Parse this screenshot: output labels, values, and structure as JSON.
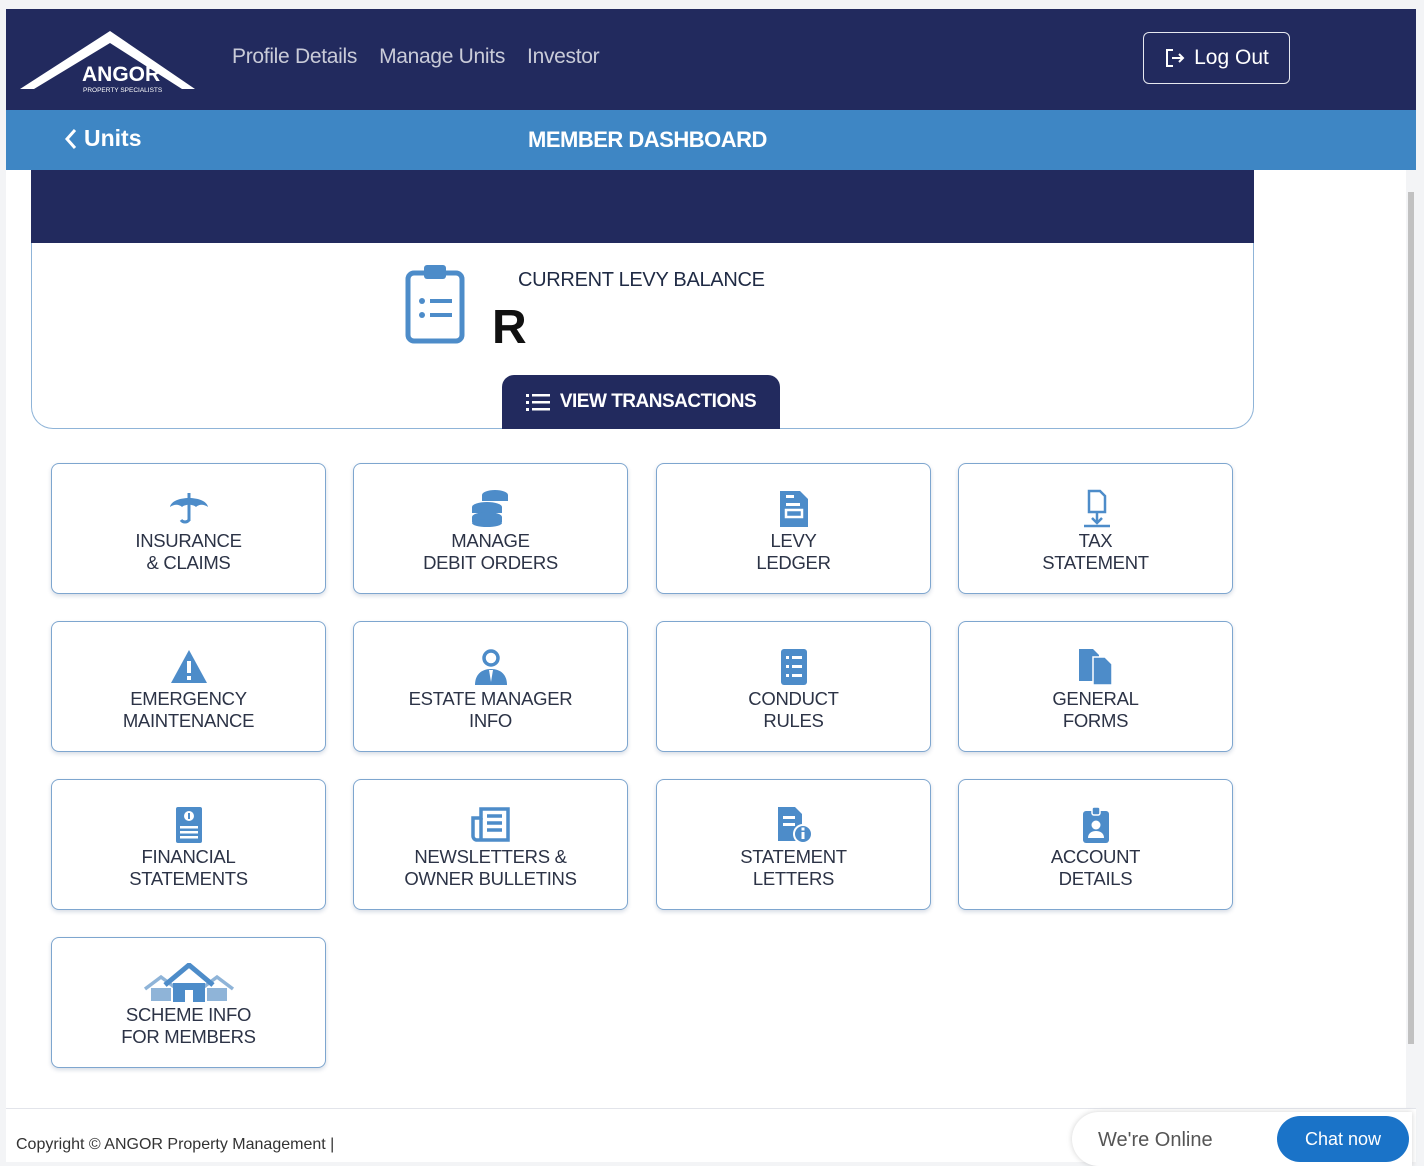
{
  "brand": {
    "name": "ANGOR",
    "tagline": "PROPERTY SPECIALISTS"
  },
  "nav": {
    "items": [
      "Profile Details",
      "Manage Units",
      "Investor"
    ],
    "logout_label": "Log Out"
  },
  "subheader": {
    "back_label": "Units",
    "title": "MEMBER DASHBOARD"
  },
  "balance": {
    "label": "CURRENT LEVY BALANCE",
    "currency": "R",
    "button_label": "VIEW TRANSACTIONS"
  },
  "tiles": [
    {
      "line1": "INSURANCE",
      "line2": "& CLAIMS",
      "icon": "umbrella-icon"
    },
    {
      "line1": "MANAGE",
      "line2": "DEBIT ORDERS",
      "icon": "coins-icon"
    },
    {
      "line1": "LEVY",
      "line2": "LEDGER",
      "icon": "ledger-document-icon"
    },
    {
      "line1": "TAX",
      "line2": "STATEMENT",
      "icon": "document-download-icon"
    },
    {
      "line1": "EMERGENCY",
      "line2": "MAINTENANCE",
      "icon": "warning-icon"
    },
    {
      "line1": "ESTATE MANAGER",
      "line2": "INFO",
      "icon": "manager-user-icon"
    },
    {
      "line1": "CONDUCT",
      "line2": "RULES",
      "icon": "list-document-icon"
    },
    {
      "line1": "GENERAL",
      "line2": "FORMS",
      "icon": "files-icon"
    },
    {
      "line1": "FINANCIAL",
      "line2": "STATEMENTS",
      "icon": "finance-document-icon"
    },
    {
      "line1": "NEWSLETTERS &",
      "line2": "OWNER BULLETINS",
      "icon": "newspaper-icon"
    },
    {
      "line1": "STATEMENT",
      "line2": "LETTERS",
      "icon": "document-info-icon"
    },
    {
      "line1": "ACCOUNT",
      "line2": "DETAILS",
      "icon": "id-badge-icon"
    },
    {
      "line1": "SCHEME INFO",
      "line2": "FOR MEMBERS",
      "icon": "houses-icon"
    }
  ],
  "footer": {
    "copyright": "Copyright © ANGOR Property Management |"
  },
  "chat": {
    "status": "We're Online",
    "button_label": "Chat now"
  },
  "colors": {
    "navy": "#222a5e",
    "blue": "#3e86c4",
    "icon_blue": "#4d8cc9",
    "chat_blue": "#1a73c8"
  }
}
